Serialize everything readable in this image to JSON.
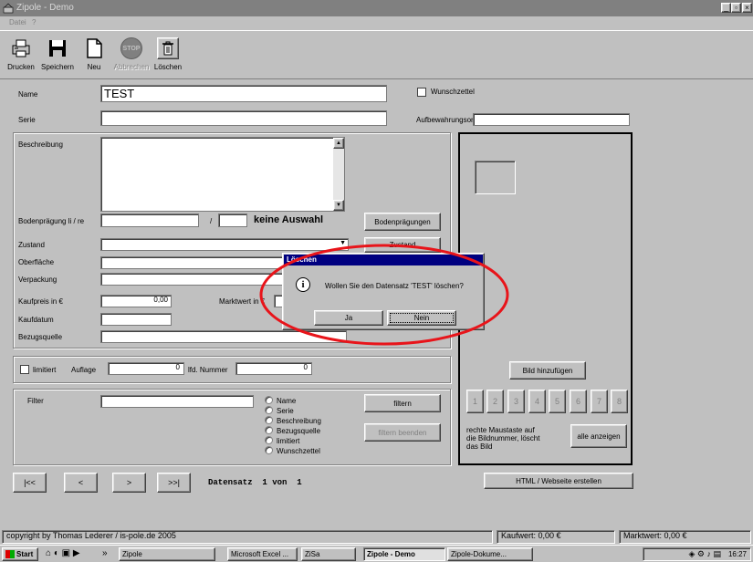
{
  "window": {
    "title": "Zipole - Demo"
  },
  "menu": [
    "Datei",
    "?"
  ],
  "toolbar": {
    "print": "Drucken",
    "save": "Speichern",
    "new": "Neu",
    "abort": "Abbrechen",
    "delete": "Löschen",
    "stop_text": "STOP"
  },
  "form": {
    "name_label": "Name",
    "name_value": "TEST",
    "wish_label": "Wunschzettel",
    "series_label": "Serie",
    "storage_label": "Aufbewahrungsort",
    "desc_label": "Beschreibung",
    "bottom_label": "Bodenprägung li / re",
    "slash": "/",
    "no_selection": "keine Auswahl",
    "bottom_btn": "Bodenprägungen",
    "condition_label": "Zustand",
    "condition_btn": "Zustand",
    "surface_label": "Oberfläche",
    "packaging_label": "Verpackung",
    "price_label": "Kaufpreis in €",
    "price_value": "0,00",
    "market_label": "Marktwert in €",
    "date_label": "Kaufdatum",
    "source_label": "Bezugsquelle"
  },
  "limit": {
    "limited_label": "limitiert",
    "edition_label": "Auflage",
    "edition_value": "0",
    "running_label": "lfd. Nummer",
    "running_value": "0"
  },
  "filter": {
    "label": "Filter",
    "options": [
      "Name",
      "Serie",
      "Beschreibung",
      "Bezugsquelle",
      "limitiert",
      "Wunschzettel"
    ],
    "filter_btn": "filtern",
    "end_btn": "filtern beenden"
  },
  "image": {
    "add_btn": "Bild hinzufügen",
    "numbers": [
      "1",
      "2",
      "3",
      "4",
      "5",
      "6",
      "7",
      "8"
    ],
    "hint_line1": "rechte Maustaste auf",
    "hint_line2": "die Bildnummer, löscht",
    "hint_line3": "das Bild",
    "show_all_btn": "alle anzeigen",
    "html_btn": "HTML / Webseite erstellen"
  },
  "nav": {
    "first": "|<<",
    "prev": "<",
    "next": ">",
    "last": ">>|",
    "record_text": "Datensatz  1 von  1"
  },
  "dialog": {
    "title": "Löschen",
    "message": "Wollen Sie den Datensatz 'TEST' löschen?",
    "yes": "Ja",
    "no": "Nein"
  },
  "status": {
    "copyright": "copyright by Thomas Lederer / is-pole.de 2005",
    "purchase": "Kaufwert: 0,00 €",
    "market": "Marktwert: 0,00 €"
  },
  "taskbar": {
    "start": "Start",
    "more": "»",
    "tasks": [
      "Zipole",
      "Microsoft Excel ...",
      "ZiSa",
      "Zipole - Demo",
      "Zipole-Dokume..."
    ],
    "clock": "16:27"
  },
  "colors": {
    "highlight": "#e8141a",
    "titlebar": "#808080",
    "dialog_title": "#000080"
  }
}
